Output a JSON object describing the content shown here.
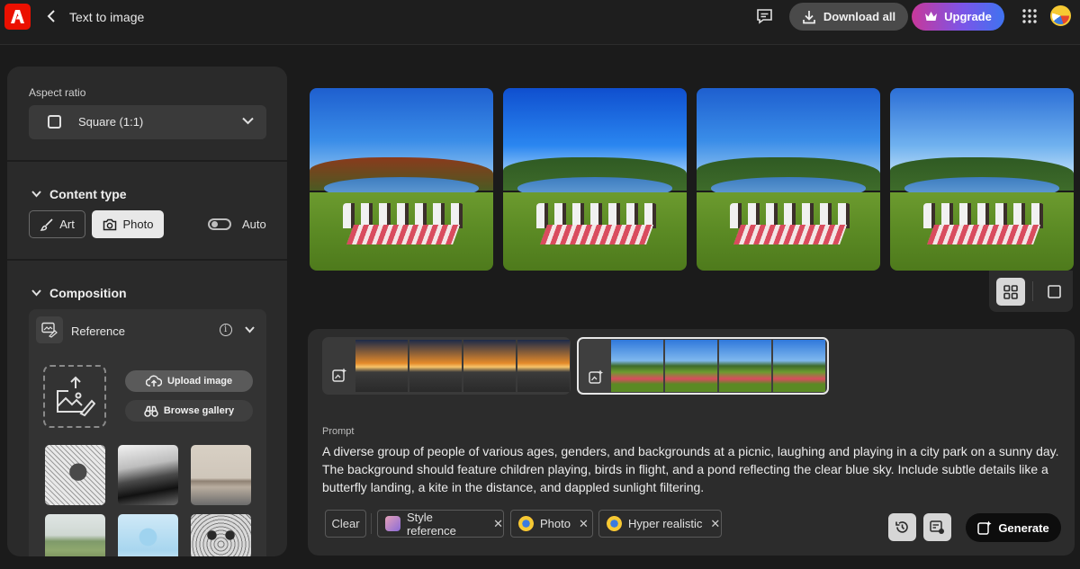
{
  "header": {
    "page_title": "Text to image",
    "download_all_label": "Download all",
    "upgrade_label": "Upgrade"
  },
  "sidebar": {
    "aspect_ratio": {
      "label": "Aspect ratio",
      "value": "Square (1:1)"
    },
    "content_type": {
      "title": "Content type",
      "art_label": "Art",
      "photo_label": "Photo",
      "selected": "Photo",
      "auto_label": "Auto",
      "auto_enabled": false
    },
    "composition": {
      "title": "Composition",
      "reference_label": "Reference",
      "upload_label": "Upload image",
      "gallery_label": "Browse gallery"
    }
  },
  "prompt": {
    "label": "Prompt",
    "text": "A diverse group of people of various ages, genders, and backgrounds at a picnic, laughing and playing in a city park on a sunny day. The background should feature children playing, birds in flight, and a pond reflecting the clear blue sky. Include subtle details like a butterfly landing, a kite in the distance, and dappled sunlight filtering.",
    "clear_label": "Clear",
    "tags": [
      {
        "label": "Style reference"
      },
      {
        "label": "Photo"
      },
      {
        "label": "Hyper realistic"
      }
    ],
    "generate_label": "Generate"
  },
  "colors": {
    "background": "#1b1b1b",
    "panel": "#2a2a2a",
    "adobe_red": "#eb1000",
    "upgrade_gradient_start": "#c8389a",
    "upgrade_gradient_end": "#3f73f0"
  },
  "icons": {
    "logo": "adobe-logo-icon",
    "back": "chevron-left-icon",
    "feedback": "feedback-icon",
    "download": "download-icon",
    "crown": "crown-icon",
    "apps": "app-grid-icon"
  }
}
